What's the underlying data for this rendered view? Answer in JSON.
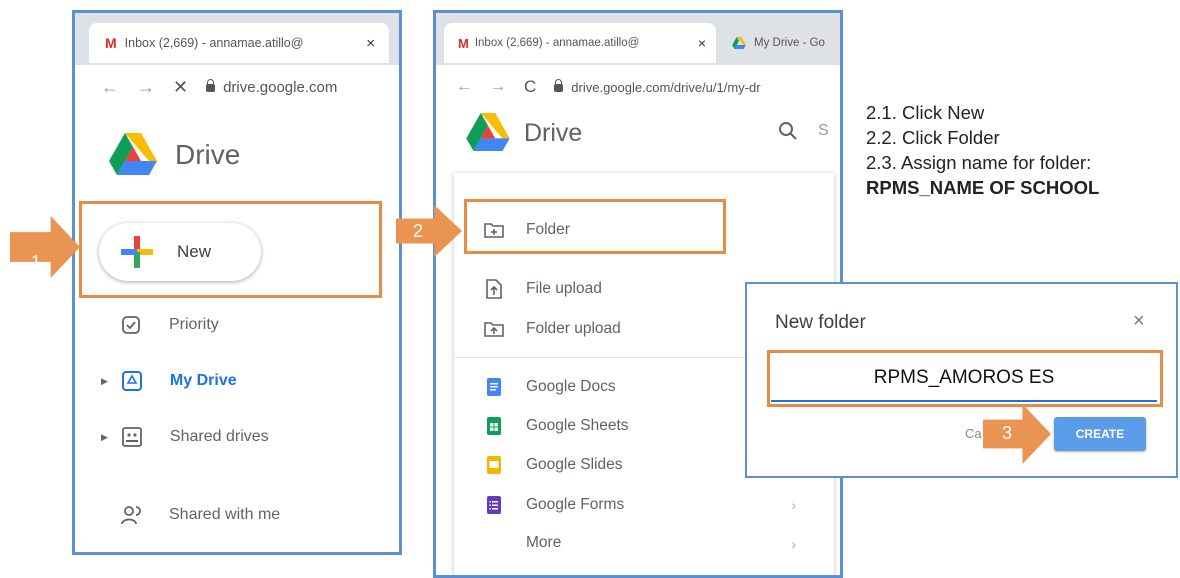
{
  "panel1": {
    "tab_title": "Inbox (2,669) - annamae.atillo@",
    "tab_close": "×",
    "address": "drive.google.com",
    "app_name": "Drive",
    "new_label": "New",
    "nav_items": [
      {
        "label": "Priority",
        "icon": "priority-icon"
      },
      {
        "label": "My Drive",
        "icon": "my-drive-icon"
      },
      {
        "label": "Shared drives",
        "icon": "shared-drives-icon"
      },
      {
        "label": "Shared with me",
        "icon": "shared-with-me-icon"
      }
    ]
  },
  "panel2": {
    "tab1_title": "Inbox (2,669) - annamae.atillo@",
    "tab1_close": "×",
    "tab2_title": "My Drive - Go",
    "address": "drive.google.com/drive/u/1/my-dr",
    "app_name": "Drive",
    "search_hint": "S",
    "menu_items": [
      {
        "label": "Folder",
        "icon": "new-folder-icon"
      },
      {
        "label": "File upload",
        "icon": "file-upload-icon"
      },
      {
        "label": "Folder upload",
        "icon": "folder-upload-icon"
      },
      {
        "label": "Google Docs",
        "icon": "google-docs-icon"
      },
      {
        "label": "Google Sheets",
        "icon": "google-sheets-icon"
      },
      {
        "label": "Google Slides",
        "icon": "google-slides-icon"
      },
      {
        "label": "Google Forms",
        "icon": "google-forms-icon"
      },
      {
        "label": "More",
        "icon": ""
      }
    ],
    "chevron": "›"
  },
  "dialog": {
    "title": "New folder",
    "close": "×",
    "input_value": "RPMS_AMOROS ES",
    "cancel_label": "Ca",
    "create_label": "CREATE"
  },
  "instructions": {
    "step1": "2.1. Click New",
    "step2": "2.2. Click Folder",
    "step3": "2.3. Assign name for folder:",
    "folder_name": "RPMS_NAME OF SCHOOL"
  },
  "arrows": {
    "a1": "1",
    "a2": "2",
    "a3": "3"
  },
  "colors": {
    "highlight": "#e98b45",
    "panel_border": "#5b8fd6",
    "drive_blue": "#1a73e8",
    "create_button": "#4a90e2"
  }
}
